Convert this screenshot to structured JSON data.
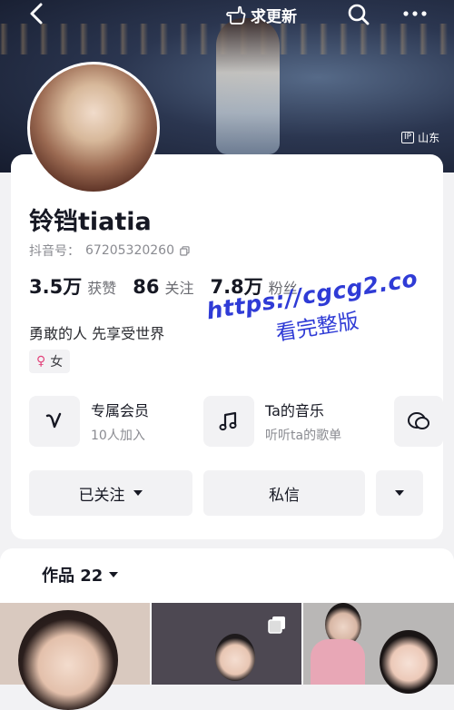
{
  "topbar": {
    "seek_update_label": "求更新"
  },
  "location": {
    "ip_tag": "IP",
    "region": "山东"
  },
  "profile": {
    "name": "铃铛tiatia",
    "douyin_id_label": "抖音号：",
    "douyin_id": "67205320260",
    "stats": [
      {
        "value": "3.5万",
        "label": "获赞"
      },
      {
        "value": "86",
        "label": "关注"
      },
      {
        "value": "7.8万",
        "label": "粉丝"
      }
    ],
    "bio": "勇敢的人  先享受世界",
    "gender": "女"
  },
  "features": [
    {
      "title": "专属会员",
      "subtitle": "10人加入",
      "icon": "v-heart-icon"
    },
    {
      "title": "Ta的音乐",
      "subtitle": "听听ta的歌单",
      "icon": "music-note-icon"
    },
    {
      "title": "",
      "subtitle": "",
      "icon": "chat-bubble-icon"
    }
  ],
  "actions": {
    "following_label": "已关注",
    "message_label": "私信"
  },
  "watermark": {
    "url": "https://cgcg2.co",
    "text": "看完整版"
  },
  "works": {
    "label": "作品 22"
  },
  "colors": {
    "accent_pink": "#e2457c",
    "watermark_blue": "#2f3bd6"
  }
}
